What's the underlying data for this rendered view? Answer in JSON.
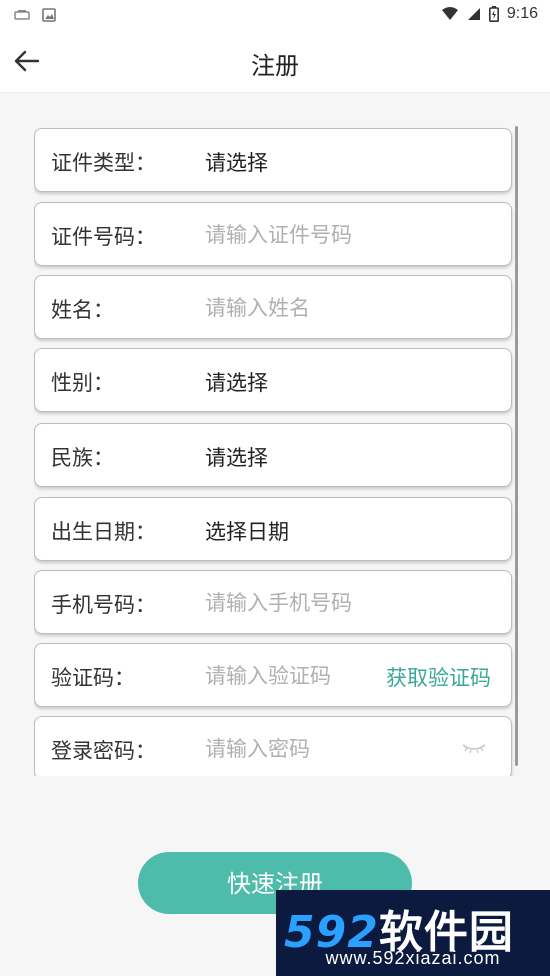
{
  "status_bar": {
    "time": "9:16",
    "icons": [
      "notification-icon",
      "image-icon",
      "wifi-icon",
      "signal-icon",
      "battery-icon"
    ]
  },
  "header": {
    "title": "注册",
    "back_icon": "arrow-left-icon"
  },
  "form": {
    "fields": [
      {
        "label": "证件类型：",
        "value": "请选择"
      },
      {
        "label": "证件号码：",
        "placeholder": "请输入证件号码"
      },
      {
        "label": "姓名：",
        "placeholder": "请输入姓名"
      },
      {
        "label": "性别：",
        "value": "请选择"
      },
      {
        "label": "民族：",
        "value": "请选择"
      },
      {
        "label": "出生日期：",
        "value": "选择日期"
      },
      {
        "label": "手机号码：",
        "placeholder": "请输入手机号码"
      },
      {
        "label": "验证码：",
        "placeholder": "请输入验证码",
        "action": "获取验证码"
      },
      {
        "label": "登录密码：",
        "placeholder": "请输入密码",
        "icon": "eye-closed-icon"
      }
    ]
  },
  "submit_label": "快速注册",
  "watermark": {
    "number": "592",
    "name": "软件园",
    "url": "www.592xiazai.com"
  },
  "colors": {
    "accent": "#4dbcaa",
    "link": "#3aa899",
    "border": "#bdbdbd",
    "background": "#f6f6f6"
  }
}
